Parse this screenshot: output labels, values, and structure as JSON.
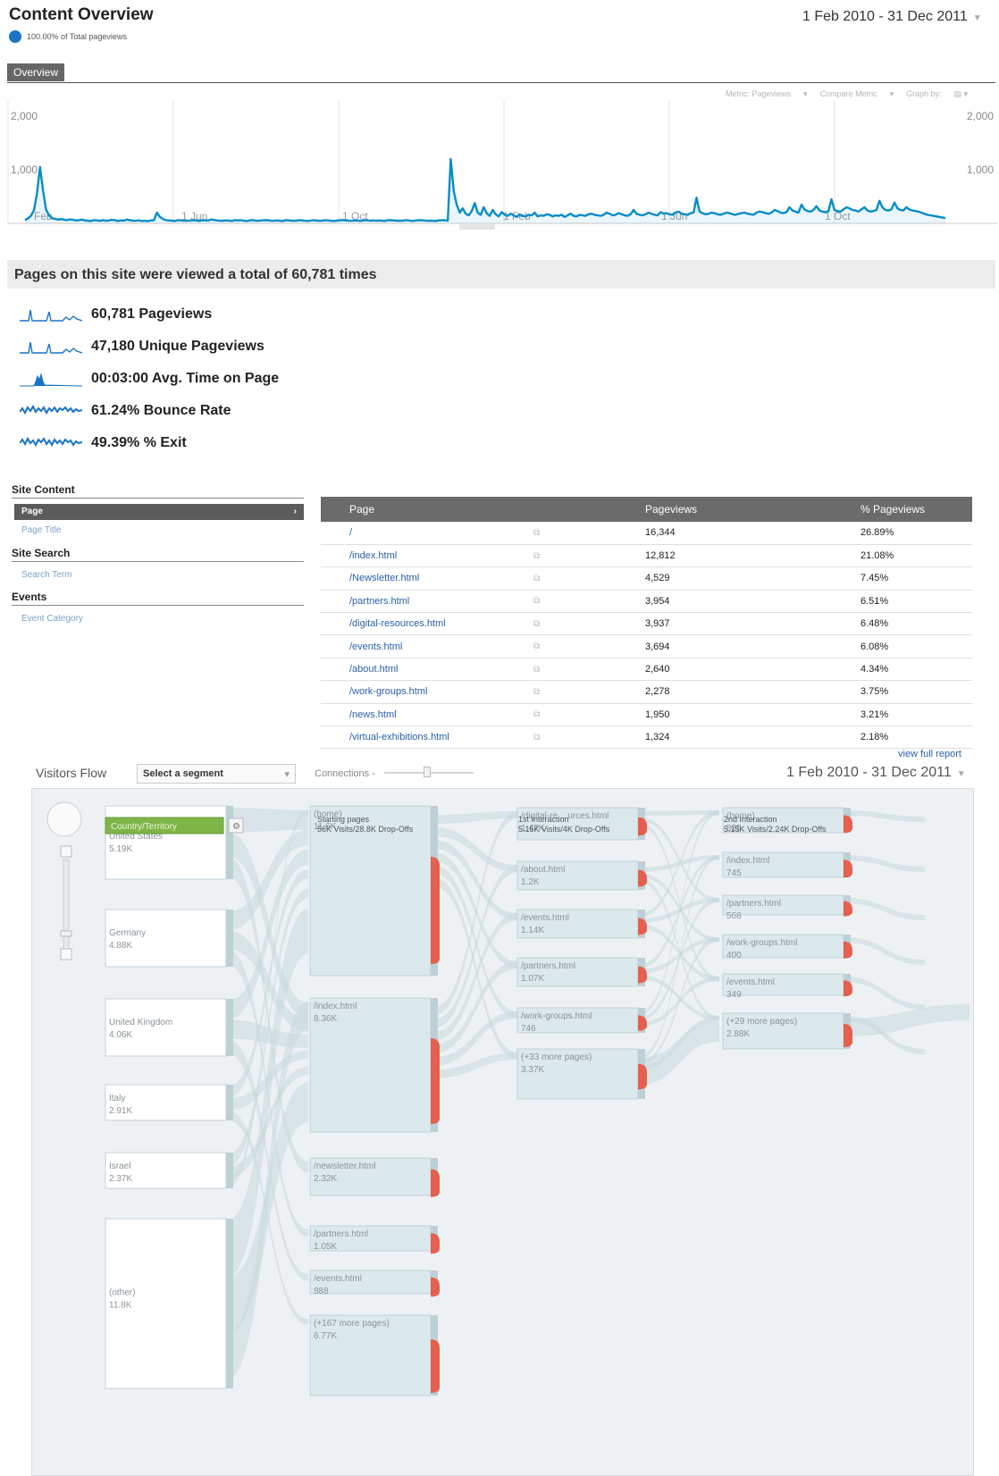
{
  "header": {
    "title": "Content Overview",
    "subtitle": "100.00% of Total pageviews",
    "date_range": "1 Feb 2010 - 31 Dec 2011"
  },
  "tabs": {
    "overview": "Overview"
  },
  "chart_controls": {
    "metric": "Metric: Pageviews",
    "compare": "Compare Metric",
    "graph_by": "Graph by:"
  },
  "chart_data": {
    "type": "line",
    "title": "",
    "series": [
      {
        "name": "Pageviews",
        "color": "#058dc7",
        "values": [
          60,
          95,
          140,
          250,
          560,
          1050,
          620,
          260,
          150,
          95,
          85,
          70,
          80,
          70,
          60,
          75,
          65,
          55,
          60,
          70,
          55,
          50,
          45,
          60,
          55,
          48,
          60,
          50,
          55,
          65,
          58,
          45,
          55,
          50,
          70,
          60,
          50,
          48,
          55,
          45,
          50,
          42,
          55,
          60,
          200,
          120,
          80,
          60,
          55,
          50,
          45,
          60,
          55,
          50,
          48,
          52,
          60,
          58,
          45,
          55,
          60,
          50,
          70,
          65,
          55,
          48,
          50,
          55,
          52,
          45,
          60,
          55,
          58,
          50,
          45,
          55,
          62,
          50,
          48,
          55,
          60,
          58,
          52,
          48,
          55,
          50,
          45,
          60,
          55,
          50,
          48,
          55,
          60,
          52,
          45,
          50,
          58,
          55,
          50,
          48,
          60,
          55,
          50,
          45,
          52,
          58,
          60,
          55,
          50,
          48,
          55,
          52,
          45,
          58,
          60,
          50,
          55,
          48,
          55,
          50,
          45,
          60,
          58,
          55,
          50,
          52,
          48,
          60,
          55,
          45,
          50,
          58,
          60,
          55,
          48,
          52,
          50,
          45,
          55,
          60,
          58,
          50,
          1200,
          600,
          350,
          200,
          280,
          180,
          150,
          230,
          380,
          200,
          160,
          300,
          190,
          140,
          250,
          170,
          130,
          210,
          160,
          140,
          180,
          150,
          120,
          170,
          140,
          130,
          160,
          150,
          200,
          130,
          150,
          140,
          170,
          160,
          130,
          150,
          140,
          160,
          120,
          150,
          180,
          140,
          130,
          160,
          150,
          140,
          170,
          180,
          160,
          150,
          140,
          160,
          200,
          180,
          150,
          160,
          190,
          170,
          150,
          140,
          170,
          250,
          180,
          160,
          150,
          170,
          200,
          180,
          160,
          150,
          210,
          180,
          190,
          170,
          160,
          200,
          220,
          180,
          170,
          160,
          190,
          200,
          480,
          220,
          190,
          170,
          180,
          200,
          190,
          170,
          160,
          180,
          200,
          190,
          170,
          160,
          180,
          190,
          200,
          180,
          170,
          160,
          200,
          220,
          210,
          190,
          180,
          200,
          250,
          230,
          200,
          190,
          210,
          300,
          240,
          220,
          200,
          350,
          260,
          230,
          220,
          250,
          320,
          240,
          220,
          210,
          230,
          450,
          250,
          230,
          220,
          260,
          300,
          280,
          250,
          240,
          220,
          260,
          300,
          240,
          220,
          230,
          250,
          420,
          300,
          250,
          240,
          260,
          390,
          280,
          250,
          240,
          300,
          260,
          240,
          230,
          220,
          200,
          180,
          160,
          150,
          140,
          130,
          120,
          110,
          100
        ],
        "peak_label": ""
      }
    ],
    "x_labels": [
      "Feb",
      "1 Jun",
      "1 Oct",
      "1 Feb",
      "1 Jun",
      "1 Oct"
    ],
    "y_ticks": [
      "2,000",
      "1,000"
    ],
    "ylim": [
      0,
      2000
    ]
  },
  "summary": {
    "banner": "Pages on this site were viewed a total of 60,781 times",
    "metrics": [
      {
        "value": "60,781 Pageviews"
      },
      {
        "value": "47,180 Unique Pageviews"
      },
      {
        "value": "00:03:00 Avg. Time on Page"
      },
      {
        "value": "61.24% Bounce Rate"
      },
      {
        "value": "49.39% % Exit"
      }
    ]
  },
  "nav": {
    "site_content": "Site Content",
    "page": "Page",
    "page_title": "Page Title",
    "site_search": "Site Search",
    "search_term": "Search Term",
    "events": "Events",
    "event_category": "Event Category"
  },
  "table": {
    "headers": [
      "Page",
      "Pageviews",
      "% Pageviews"
    ],
    "rows": [
      {
        "page": "/",
        "pageviews": "16,344",
        "pct": "26.89%"
      },
      {
        "page": "/index.html",
        "pageviews": "12,812",
        "pct": "21.08%"
      },
      {
        "page": "/Newsletter.html",
        "pageviews": "4,529",
        "pct": "7.45%"
      },
      {
        "page": "/partners.html",
        "pageviews": "3,954",
        "pct": "6.51%"
      },
      {
        "page": "/digital-resources.html",
        "pageviews": "3,937",
        "pct": "6.48%"
      },
      {
        "page": "/events.html",
        "pageviews": "3,694",
        "pct": "6.08%"
      },
      {
        "page": "/about.html",
        "pageviews": "2,640",
        "pct": "4.34%"
      },
      {
        "page": "/work-groups.html",
        "pageviews": "2,278",
        "pct": "3.75%"
      },
      {
        "page": "/news.html",
        "pageviews": "1,950",
        "pct": "3.21%"
      },
      {
        "page": "/virtual-exhibitions.html",
        "pageviews": "1,324",
        "pct": "2.18%"
      }
    ],
    "view_full": "view full report"
  },
  "flow": {
    "title": "Visitors Flow",
    "segment": "Select a segment",
    "connections": "Connections -",
    "date_range": "1 Feb 2010 - 31 Dec 2011",
    "dimension": "Country/Territory",
    "col_heads": [
      {
        "title": "Starting pages",
        "sub": "56K Visits/28.8K Drop-Offs"
      },
      {
        "title": "1st Interaction",
        "sub": "5.15K Visits/4K Drop-Offs"
      },
      {
        "title": "2nd Interaction",
        "sub": "5.15K Visits/2.24K Drop-Offs"
      }
    ],
    "countries": [
      {
        "name": "United States",
        "val": "5.19K"
      },
      {
        "name": "Germany",
        "val": "4.88K"
      },
      {
        "name": "United Kingdom",
        "val": "4.06K"
      },
      {
        "name": "Italy",
        "val": "2.91K"
      },
      {
        "name": "Israel",
        "val": "2.37K"
      },
      {
        "name": "(other)",
        "val": "11.8K"
      }
    ],
    "start_pages": [
      {
        "name": "(home)",
        "val": "11.6K"
      },
      {
        "name": "/index.html",
        "val": "8.36K"
      },
      {
        "name": "/newsletter.html",
        "val": "2.32K"
      },
      {
        "name": "/partners.html",
        "val": "1.05K"
      },
      {
        "name": "/events.html",
        "val": "888"
      },
      {
        "name": "(+167 more pages)",
        "val": "6.77K"
      }
    ],
    "first": [
      {
        "name": "/digital-re....urces.html",
        "val": "1.47K"
      },
      {
        "name": "/about.html",
        "val": "1.2K"
      },
      {
        "name": "/events.html",
        "val": "1.14K"
      },
      {
        "name": "/partners.html",
        "val": "1.07K"
      },
      {
        "name": "/work-groups.html",
        "val": "746"
      },
      {
        "name": "(+33 more pages)",
        "val": "3.37K"
      }
    ],
    "second": [
      {
        "name": "(home)",
        "val": "825"
      },
      {
        "name": "/index.html",
        "val": "745"
      },
      {
        "name": "/partners.html",
        "val": "568"
      },
      {
        "name": "/work-groups.html",
        "val": "400"
      },
      {
        "name": "/events.html",
        "val": "349"
      },
      {
        "name": "(+29 more pages)",
        "val": "2.88K"
      }
    ]
  }
}
